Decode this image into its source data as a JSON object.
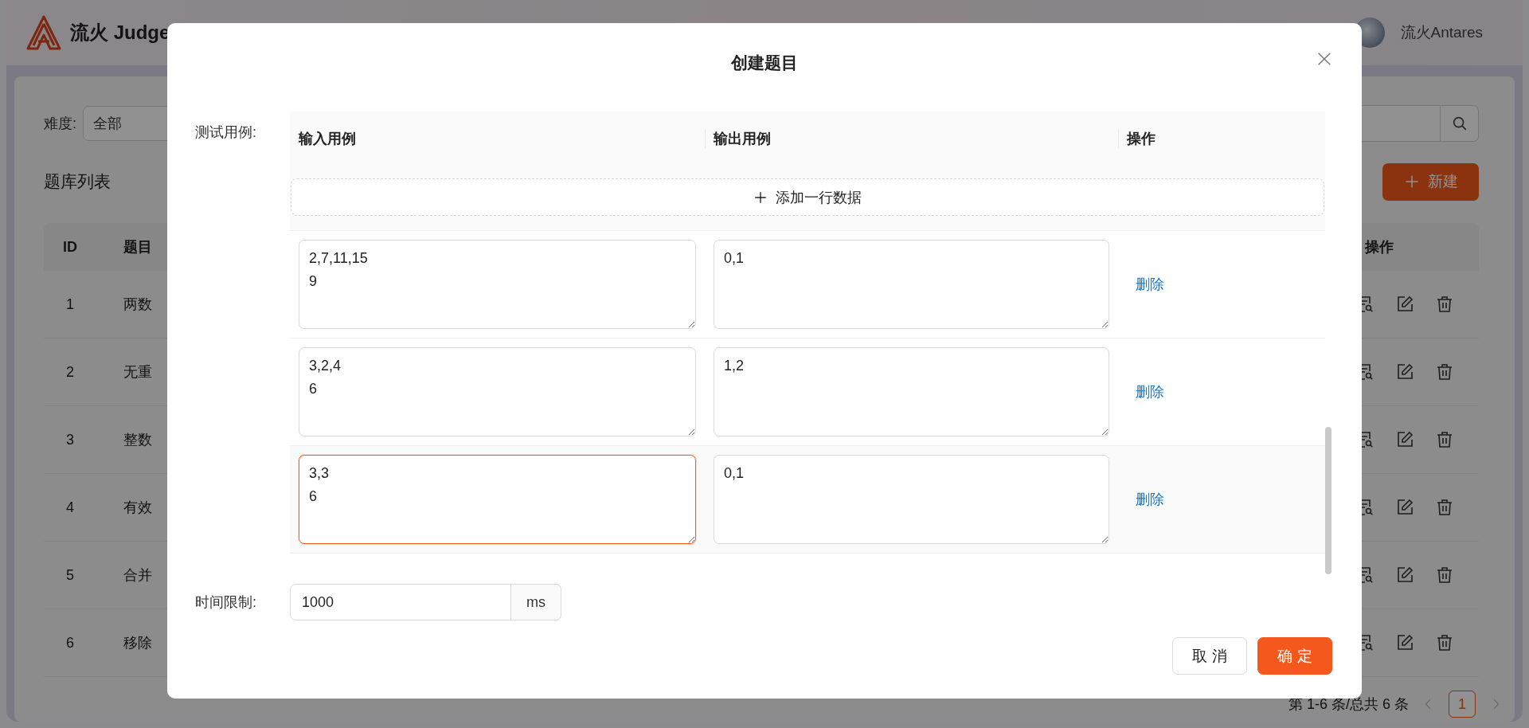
{
  "header": {
    "app_name": "流火 Judge",
    "user_name": "流火Antares"
  },
  "filters": {
    "difficulty_label": "难度:",
    "difficulty_value": "全部"
  },
  "list_title": "题库列表",
  "new_button": "新建",
  "table": {
    "columns": [
      "ID",
      "题目",
      "操作"
    ],
    "rows": [
      {
        "id": "1",
        "title": "两数"
      },
      {
        "id": "2",
        "title": "无重"
      },
      {
        "id": "3",
        "title": "整数"
      },
      {
        "id": "4",
        "title": "有效"
      },
      {
        "id": "5",
        "title": "合并"
      },
      {
        "id": "6",
        "title": "移除"
      }
    ]
  },
  "pagination": {
    "summary": "第 1-6 条/总共 6 条",
    "pages": [
      {
        "label": "1",
        "selected": true
      }
    ]
  },
  "dialog": {
    "title": "创建题目",
    "test_cases_label": "测试用例:",
    "columns": [
      "输入用例",
      "输出用例",
      "操作"
    ],
    "add_row": "添加一行数据",
    "cases": [
      {
        "input": "2,7,11,15\n9",
        "output": "0,1",
        "action": "删除",
        "focused": false
      },
      {
        "input": "3,2,4\n6",
        "output": "1,2",
        "action": "删除",
        "focused": false
      },
      {
        "input": "3,3\n6",
        "output": "0,1",
        "action": "删除",
        "focused": true
      }
    ],
    "time_limit_label": "时间限制:",
    "time_limit_value": "1000",
    "time_limit_unit": "ms",
    "buttons": [
      {
        "label": "取 消",
        "kind": "default"
      },
      {
        "label": "确 定",
        "kind": "primary"
      }
    ]
  }
}
